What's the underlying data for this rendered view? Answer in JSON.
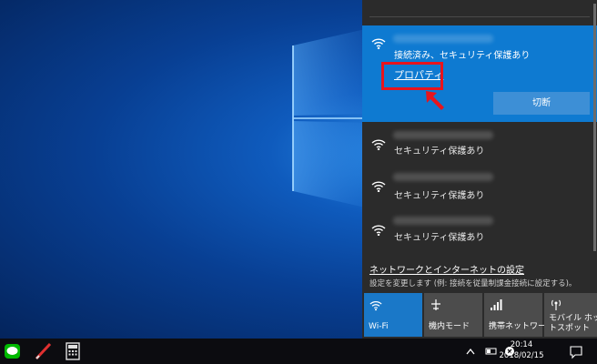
{
  "flyout": {
    "active_network": {
      "status": "接続済み、セキュリティ保護あり",
      "properties_link": "プロパティ",
      "disconnect_button": "切断"
    },
    "networks": [
      {
        "status": "セキュリティ保護あり"
      },
      {
        "status": "セキュリティ保護あり"
      },
      {
        "status": "セキュリティ保護あり"
      }
    ],
    "settings": {
      "link": "ネットワークとインターネットの設定",
      "description": "設定を変更します (例: 接続を従量制課金接続に設定する)。"
    },
    "quick_actions": [
      {
        "label": "Wi-Fi",
        "icon": "wifi-icon",
        "active": true
      },
      {
        "label": "機内モード",
        "icon": "airplane-icon",
        "active": false
      },
      {
        "label": "携帯ネットワーク",
        "icon": "cellular-icon",
        "active": false
      },
      {
        "label": "モバイル ホットスポット",
        "icon": "hotspot-icon",
        "active": false
      }
    ]
  },
  "taskbar": {
    "apps": [
      "line-app-icon",
      "pen-app-icon",
      "calculator-app-icon"
    ],
    "time": "20:14",
    "date": "2018/02/15"
  },
  "colors": {
    "accent": "#0e7ad1",
    "highlight": "#e8141c",
    "flyout_bg": "#2b2b2b"
  }
}
